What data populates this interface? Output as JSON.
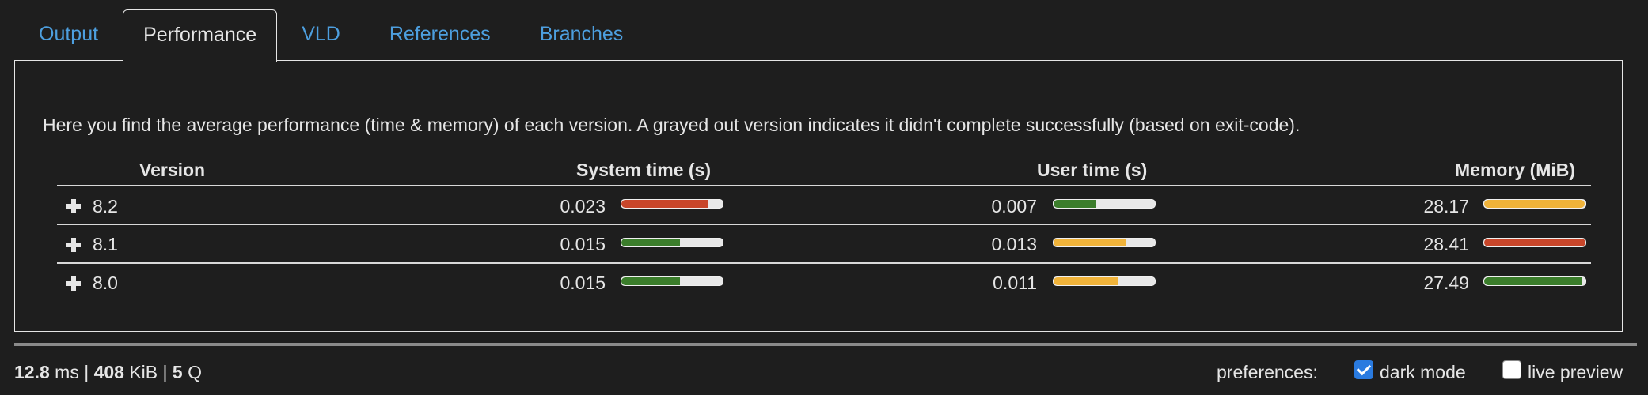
{
  "tabs": [
    {
      "label": "Output",
      "active": false
    },
    {
      "label": "Performance",
      "active": true
    },
    {
      "label": "VLD",
      "active": false
    },
    {
      "label": "References",
      "active": false
    },
    {
      "label": "Branches",
      "active": false
    }
  ],
  "intro": "Here you find the average performance (time & memory) of each version. A grayed out version indicates it didn't complete successfully (based on exit-code).",
  "columns": {
    "version": "Version",
    "system_time": "System time (s)",
    "user_time": "User time (s)",
    "memory": "Memory (MiB)"
  },
  "rows": [
    {
      "version": "8.2",
      "system_time": "0.023",
      "system_fill": 0.86,
      "system_color": "#c8462a",
      "user_time": "0.007",
      "user_fill": 0.42,
      "user_color": "#3b7d2b",
      "memory": "28.17",
      "memory_fill": 0.99,
      "memory_color": "#f0b33a"
    },
    {
      "version": "8.1",
      "system_time": "0.015",
      "system_fill": 0.58,
      "system_color": "#3b7d2b",
      "user_time": "0.013",
      "user_fill": 0.72,
      "user_color": "#f0b33a",
      "memory": "28.41",
      "memory_fill": 1.0,
      "memory_color": "#c8462a"
    },
    {
      "version": "8.0",
      "system_time": "0.015",
      "system_fill": 0.58,
      "system_color": "#3b7d2b",
      "user_time": "0.011",
      "user_fill": 0.63,
      "user_color": "#f0b33a",
      "memory": "27.49",
      "memory_fill": 0.97,
      "memory_color": "#3b7d2b"
    }
  ],
  "footer": {
    "time_value": "12.8",
    "time_unit": " ms | ",
    "mem_value": "408",
    "mem_unit": " KiB | ",
    "q_value": "5",
    "q_unit": " Q",
    "preferences_label": "preferences:",
    "dark_mode_label": "dark mode",
    "dark_mode_checked": true,
    "live_preview_label": "live preview",
    "live_preview_checked": false
  }
}
